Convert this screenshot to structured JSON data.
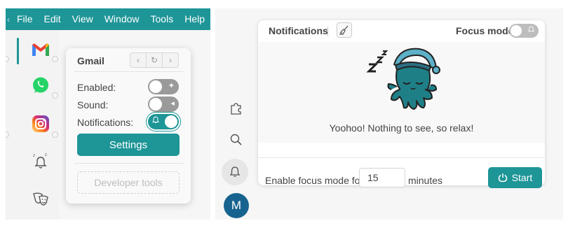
{
  "menubar": {
    "items": [
      "File",
      "Edit",
      "View",
      "Window",
      "Tools",
      "Help"
    ]
  },
  "services": [
    {
      "name": "Gmail",
      "icon": "gmail-icon"
    },
    {
      "name": "WhatsApp",
      "icon": "whatsapp-icon"
    },
    {
      "name": "Instagram",
      "icon": "instagram-icon"
    },
    {
      "name": "Notifications",
      "icon": "snooze-bell-icon"
    },
    {
      "name": "Masks",
      "icon": "theater-masks-icon"
    }
  ],
  "service_popover": {
    "title": "Gmail",
    "enabled_label": "Enabled:",
    "enabled": false,
    "sound_label": "Sound:",
    "sound": false,
    "notifications_label": "Notifications:",
    "notifications": true,
    "settings_label": "Settings",
    "developer_tools_label": "Developer tools"
  },
  "notifications_panel": {
    "title": "Notifications",
    "focus_mode_label": "Focus mode",
    "focus_mode": false,
    "empty_message": "Yoohoo! Nothing to see, so relax!",
    "focus_for_label": "Enable focus mode for",
    "minutes_value": "15",
    "minutes_unit": "minutes",
    "start_label": "Start"
  },
  "user": {
    "avatar_initial": "M"
  },
  "colors": {
    "accent": "#1e9597",
    "avatar": "#17638f",
    "mascot": "#1f7f87"
  }
}
